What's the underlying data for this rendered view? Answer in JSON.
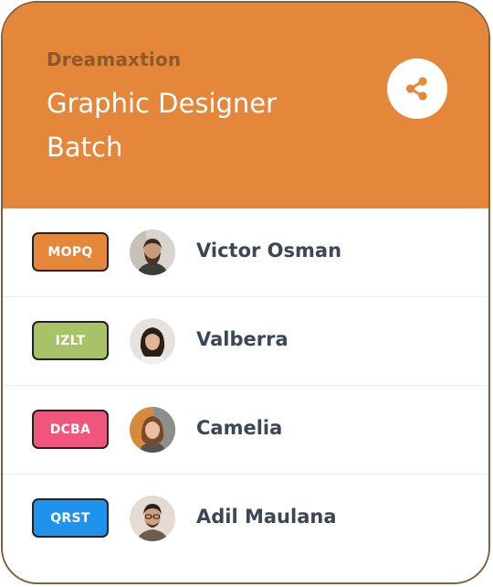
{
  "header": {
    "brand": "Dreamaxtion",
    "title": "Graphic Designer Batch",
    "share_icon": "share-icon"
  },
  "colors": {
    "header_bg": "#e5873a",
    "border": "#86603a",
    "name_text": "#3d4654"
  },
  "members": [
    {
      "code": "MOPQ",
      "badge_color": "#e5873a",
      "name": "Victor Osman",
      "avatar": "avatar-victor"
    },
    {
      "code": "IZLT",
      "badge_color": "#a9c267",
      "name": "Valberra",
      "avatar": "avatar-valberra"
    },
    {
      "code": "DCBA",
      "badge_color": "#f0557b",
      "name": "Camelia",
      "avatar": "avatar-camelia"
    },
    {
      "code": "QRST",
      "badge_color": "#1e93ee",
      "name": "Adil Maulana",
      "avatar": "avatar-adil"
    }
  ]
}
